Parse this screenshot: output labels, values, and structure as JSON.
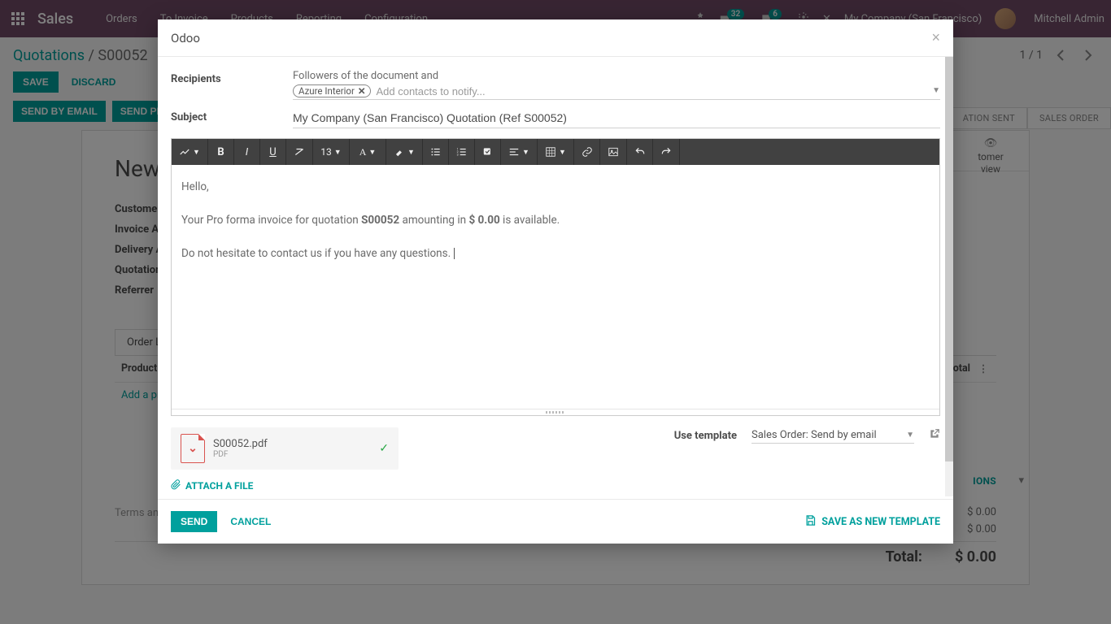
{
  "nav": {
    "brand": "Sales",
    "menu": [
      "Orders",
      "To Invoice",
      "Products",
      "Reporting",
      "Configuration"
    ],
    "msg_badge": "32",
    "chat_badge": "6",
    "company": "My Company (San Francisco)",
    "user": "Mitchell Admin"
  },
  "breadcrumb": {
    "root": "Quotations",
    "record": "S00052",
    "pager": "1 / 1"
  },
  "buttons": {
    "save": "SAVE",
    "discard": "DISCARD",
    "send_email": "SEND BY EMAIL",
    "send_proforma_partial": "SEND PR"
  },
  "status": {
    "step1_partial": "ATION SENT",
    "step2": "SALES ORDER"
  },
  "sheet": {
    "title_partial": "New",
    "labels": {
      "customer": "Customer",
      "invoice_addr": "Invoice A",
      "delivery_addr": "Delivery A",
      "quotation": "Quotation",
      "referrer": "Referrer"
    },
    "tab": "Order L",
    "col_product": "Product",
    "subtotal_hdr_partial": "total",
    "add_product_partial": "Add a pr",
    "terms_partial": "Terms an",
    "cust_preview": "Customer Preview",
    "cust_preview_p1": "tomer",
    "cust_preview_p2": "view",
    "ions_partial": "IONS",
    "tot1": "$ 0.00",
    "tot2": "$ 0.00",
    "total_lbl": "Total:",
    "total_val": "$ 0.00"
  },
  "modal": {
    "title": "Odoo",
    "recipients_lbl": "Recipients",
    "followers_text": "Followers of the document and",
    "tag": "Azure Interior",
    "add_contacts_ph": "Add contacts to notify...",
    "subject_lbl": "Subject",
    "subject_val": "My Company (San Francisco) Quotation (Ref S00052)",
    "font_size": "13",
    "body": {
      "p1": "Hello,",
      "p2_pre": "Your Pro forma invoice for quotation ",
      "p2_ref": "S00052",
      "p2_mid": " amounting in ",
      "p2_amt": "$ 0.00",
      "p2_post": " is available.",
      "p3": "Do not hesitate to contact us if you have any questions."
    },
    "attachment": {
      "name": "S00052.pdf",
      "type": "PDF"
    },
    "attach_link": "ATTACH A FILE",
    "template_lbl": "Use template",
    "template_val": "Sales Order: Send by email",
    "send": "SEND",
    "cancel": "CANCEL",
    "save_template": "SAVE AS NEW TEMPLATE"
  }
}
